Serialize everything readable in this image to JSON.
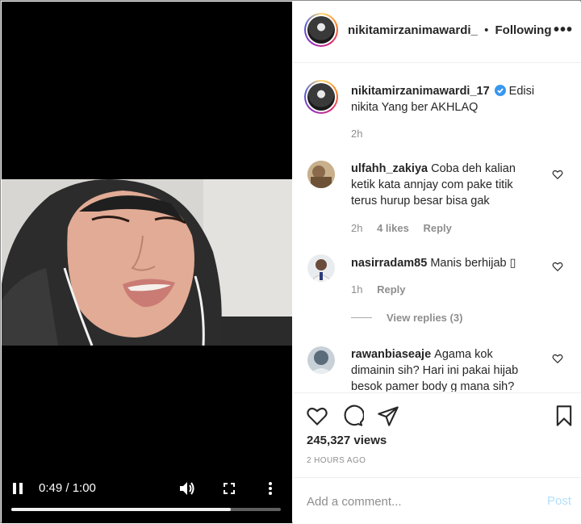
{
  "post": {
    "username": "nikitamirzanimawardi_",
    "follow_state": "Following",
    "dot": "•",
    "more": "•••"
  },
  "caption": {
    "username": "nikitamirzanimawardi_17",
    "text_line1": "Edisi",
    "text_line2": "nikita Yang ber AKHLAQ",
    "time": "2h"
  },
  "comments": [
    {
      "username": "ulfahh_zakiya",
      "text_line1": "Coba deh kalian",
      "text_line2": "ketik kata annjay com pake titik",
      "text_line3": "terus hurup besar bisa gak",
      "time": "2h",
      "likes": "4 likes",
      "reply": "Reply"
    },
    {
      "username": "nasirradam85",
      "text_line1": "Manis berhijab ▯",
      "time": "1h",
      "reply": "Reply",
      "view_replies": "View replies (3)"
    },
    {
      "username": "rawanbiaseaje",
      "text_line1": "Agama kok",
      "text_line2": "dimainin sih? Hari ini pakai hijab",
      "text_line3": "besok pamer body g mana sih?"
    }
  ],
  "stats": {
    "views": "245,327 views",
    "posted": "2 HOURS AGO"
  },
  "composer": {
    "placeholder": "Add a comment...",
    "post_label": "Post"
  },
  "video": {
    "time_label": "0:49 / 1:00",
    "progress": 0.815
  },
  "icons": {
    "heart": "heart-icon",
    "comment": "comment-icon",
    "share": "share-icon",
    "save": "bookmark-icon",
    "pause": "pause-icon",
    "volume": "volume-icon",
    "fullscreen": "fullscreen-icon",
    "menu": "kebab-menu-icon"
  },
  "colors": {
    "verified": "#3897f0",
    "post_disabled": "#b2dffc",
    "muted": "#8e8e8e"
  }
}
